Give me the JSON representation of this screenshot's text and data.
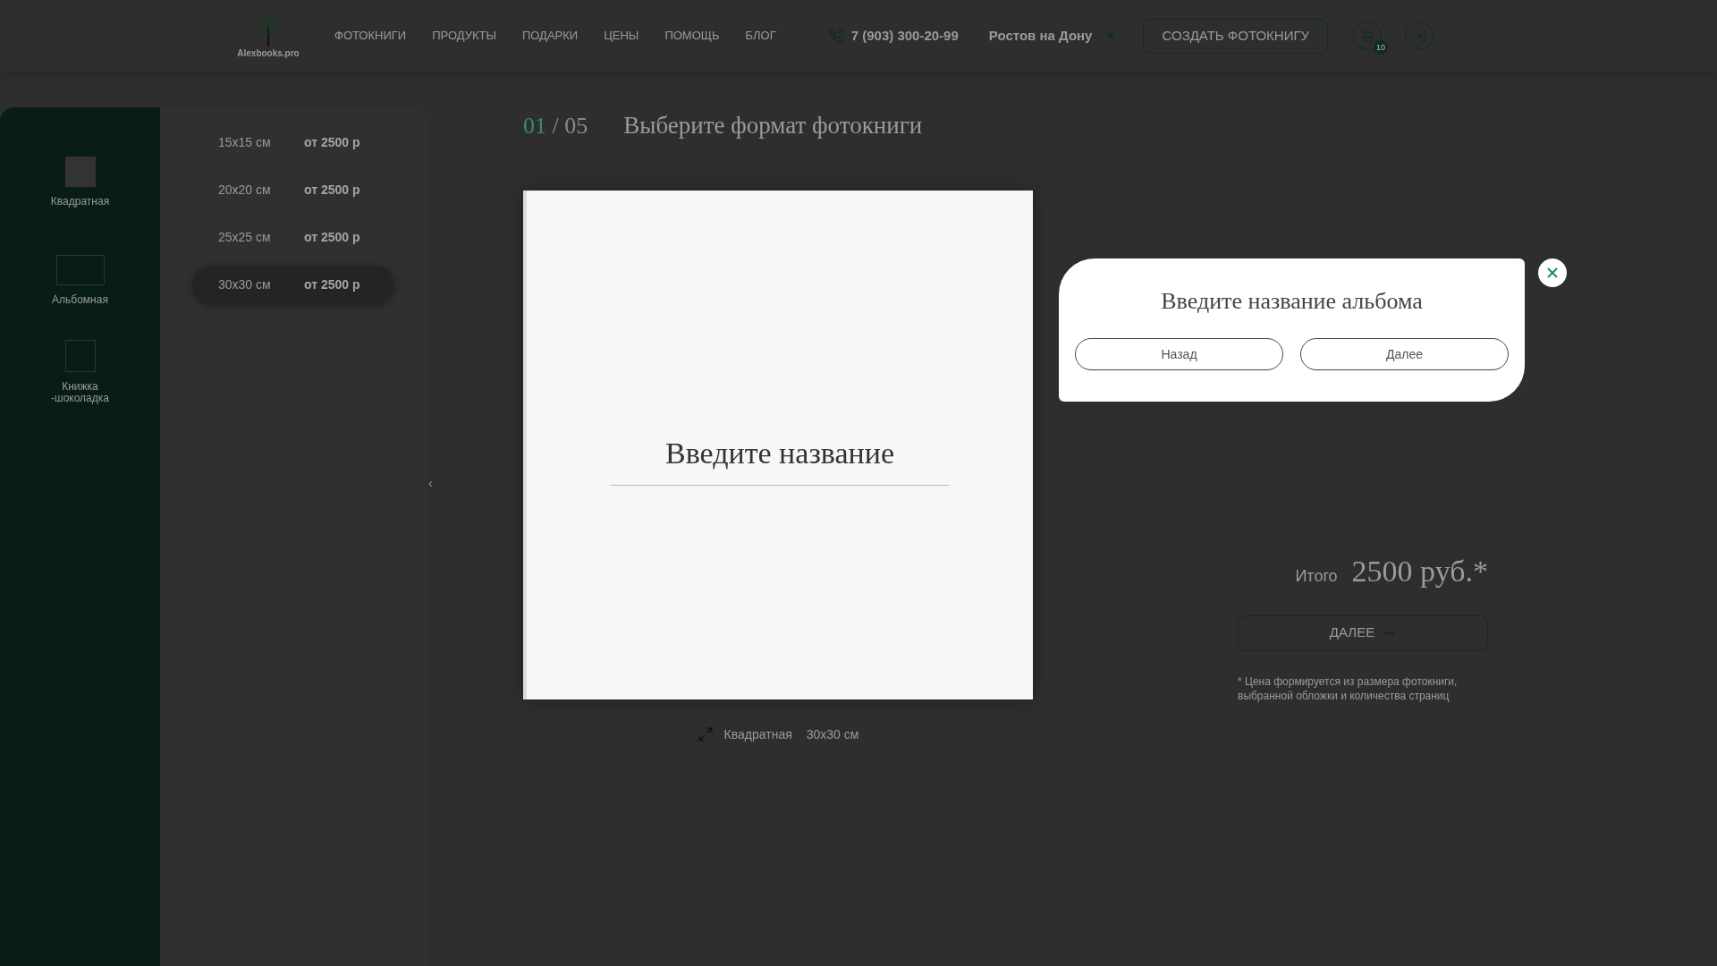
{
  "header": {
    "logo_text": "Alexbooks.pro",
    "nav": [
      "ФОТОКНИГИ",
      "ПРОДУКТЫ",
      "ПОДАРКИ",
      "ЦЕНЫ",
      "ПОМОЩЬ",
      "БЛОГ"
    ],
    "phone": "7 (903) 300-20-99",
    "city": "Ростов на Дону",
    "create_button": "СОЗДАТЬ ФОТОКНИГУ",
    "cart_badge": "10"
  },
  "formats": [
    {
      "label": "Квадратная",
      "kind": "square",
      "selected": true
    },
    {
      "label": "Альбомная",
      "kind": "landscape",
      "selected": false
    },
    {
      "label": "Книжка -шоколадка",
      "kind": "portrait",
      "selected": false
    }
  ],
  "sizes": [
    {
      "size": "15x15 см",
      "price": "от 2500 р",
      "selected": false
    },
    {
      "size": "20x20 см",
      "price": "от 2500 р",
      "selected": false
    },
    {
      "size": "25x25 см",
      "price": "от 2500 р",
      "selected": false
    },
    {
      "size": "30x30 см",
      "price": "от 2500 р",
      "selected": true
    }
  ],
  "collapse_chevron": "‹",
  "step": {
    "current": "01",
    "total": "/ 05",
    "title": "Выберите формат фотокниги"
  },
  "cover": {
    "placeholder": "Введите название"
  },
  "caption": {
    "format": "Квадратная",
    "size": "30x30 см"
  },
  "summary": {
    "total_label": "Итого",
    "total": "2500 руб.*",
    "next_button": "ДАЛЕЕ",
    "note": "* Цена формируется из размера фотокниги, выбранной обложки и количества страниц"
  },
  "modal": {
    "title": "Введите название альбома",
    "buttons": [
      "Назад",
      "Далее"
    ]
  }
}
